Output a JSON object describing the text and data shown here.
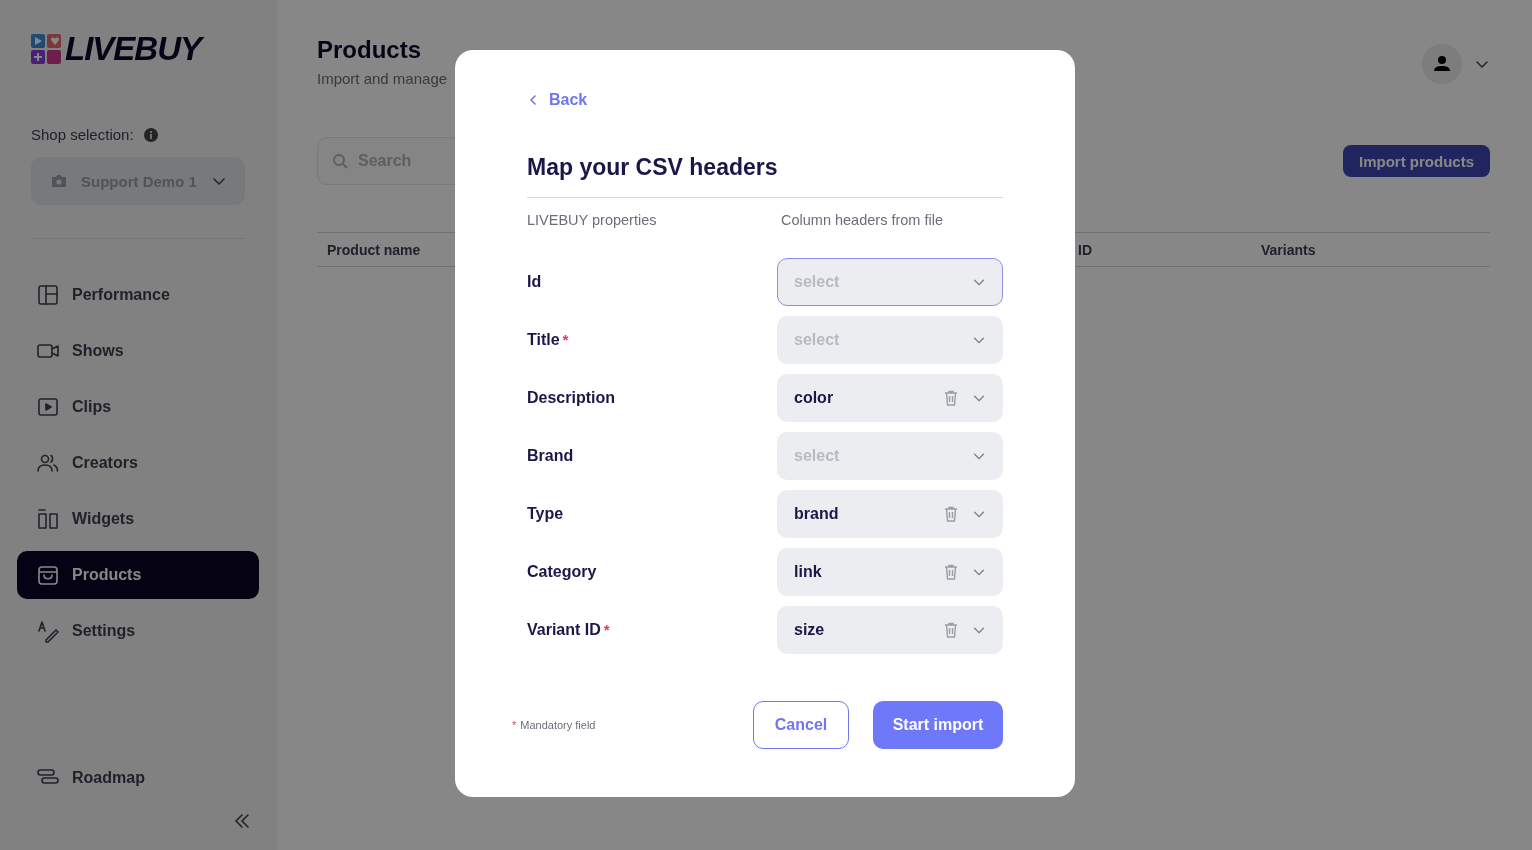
{
  "sidebar": {
    "logo": "LIVEBUY",
    "shop_label": "Shop selection:",
    "shop_select": {
      "value": "Support Demo 1",
      "disabled": true
    },
    "items": [
      {
        "label": "Performance",
        "selected": false
      },
      {
        "label": "Shows",
        "selected": false
      },
      {
        "label": "Clips",
        "selected": false
      },
      {
        "label": "Creators",
        "selected": false
      },
      {
        "label": "Widgets",
        "selected": false
      },
      {
        "label": "Products",
        "selected": true
      },
      {
        "label": "Settings",
        "selected": false
      }
    ],
    "footer_item": {
      "label": "Roadmap"
    }
  },
  "header": {
    "title": "Products",
    "subtitle": "Import and manage"
  },
  "search": {
    "placeholder": "Search"
  },
  "import_button": "Import products",
  "table": {
    "columns": [
      "Product name",
      "ID",
      "Variants"
    ]
  },
  "modal": {
    "back": "Back",
    "title": "Map your CSV headers",
    "column_left": "LIVEBUY properties",
    "column_right": "Column headers from file",
    "rows": [
      {
        "label": "Id",
        "placeholder": "select",
        "focused": true
      },
      {
        "label": "Title",
        "required_mark": "*",
        "placeholder": "select",
        "focused": false
      },
      {
        "label": "Description",
        "value": "color",
        "focused": false
      },
      {
        "label": "Brand",
        "placeholder": "select",
        "focused": false
      },
      {
        "label": "Type",
        "value": "brand",
        "focused": false
      },
      {
        "label": "Category",
        "value": "link",
        "focused": false
      },
      {
        "label": "Variant ID",
        "required_mark": "*",
        "value": "size",
        "focused": false
      }
    ],
    "footnote": {
      "mark": "*",
      "text": "Mandatory field"
    },
    "cancel": "Cancel",
    "submit": "Start import"
  }
}
